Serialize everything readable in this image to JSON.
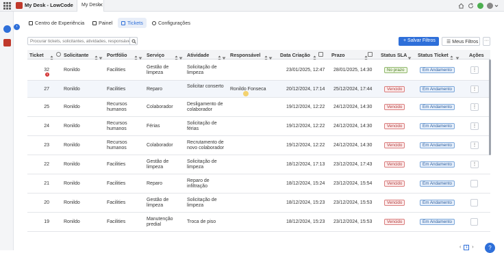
{
  "topbar": {
    "app_title": "My Desk - LowCode",
    "tab_label": "My Desk",
    "tab_close": "✕"
  },
  "nav": [
    {
      "label": "Centro de Experiência"
    },
    {
      "label": "Painel"
    },
    {
      "label": "Tickets"
    },
    {
      "label": "Configurações"
    }
  ],
  "search": {
    "placeholder": "Procurar tickets, solicitantes, atividades, responsável..."
  },
  "actions": {
    "save": "Salvar Filtros",
    "filters": "Meus Filtros",
    "more": "···"
  },
  "columns": [
    "Ticket",
    "Solicitante",
    "Portfólio",
    "Serviço",
    "Atividade",
    "Responsável",
    "Data Criação",
    "Prazo",
    "Status SLA",
    "Status Ticket",
    "Ações"
  ],
  "rows": [
    {
      "ticket": "32",
      "badge": "1",
      "solicitante": "Ronildo",
      "portfolio": "Facilities",
      "servico": "Gestão de limpeza",
      "atividade": "Solicitação de limpeza",
      "responsavel": "",
      "criacao": "23/01/2025, 12:47",
      "prazo": "28/01/2025, 14:30",
      "sla": "No prazo",
      "status": "Em Andamento",
      "acao": "⋮"
    },
    {
      "ticket": "27",
      "badge": "",
      "solicitante": "Ronildo",
      "portfolio": "Facilities",
      "servico": "Reparo",
      "atividade": "Solicitar conserto",
      "responsavel": "Ronildo Fonseca",
      "criacao": "20/12/2024, 17:14",
      "prazo": "25/12/2024, 17:44",
      "sla": "Vencido",
      "status": "Em Andamento",
      "acao": "⋮"
    },
    {
      "ticket": "25",
      "badge": "",
      "solicitante": "Ronildo",
      "portfolio": "Recursos humanos",
      "servico": "Colaborador",
      "atividade": "Desligamento de colaborador",
      "responsavel": "",
      "criacao": "19/12/2024, 12:22",
      "prazo": "24/12/2024, 14:30",
      "sla": "Vencido",
      "status": "Em Andamento",
      "acao": "⋮"
    },
    {
      "ticket": "24",
      "badge": "",
      "solicitante": "Ronildo",
      "portfolio": "Recursos humanos",
      "servico": "Férias",
      "atividade": "Solicitação de férias",
      "responsavel": "",
      "criacao": "19/12/2024, 12:22",
      "prazo": "24/12/2024, 14:30",
      "sla": "Vencido",
      "status": "Em Andamento",
      "acao": "⋮"
    },
    {
      "ticket": "23",
      "badge": "",
      "solicitante": "Ronildo",
      "portfolio": "Recursos humanos",
      "servico": "Colaborador",
      "atividade": "Recrutamento de novo colaborador",
      "responsavel": "",
      "criacao": "19/12/2024, 12:22",
      "prazo": "24/12/2024, 14:30",
      "sla": "Vencido",
      "status": "Em Andamento",
      "acao": "⋮"
    },
    {
      "ticket": "22",
      "badge": "",
      "solicitante": "Ronildo",
      "portfolio": "Facilities",
      "servico": "Gestão de limpeza",
      "atividade": "Solicitação de limpeza",
      "responsavel": "",
      "criacao": "18/12/2024, 17:13",
      "prazo": "23/12/2024, 17:43",
      "sla": "Vencido",
      "status": "Em Andamento",
      "acao": "⋮"
    },
    {
      "ticket": "21",
      "badge": "",
      "solicitante": "Ronildo",
      "portfolio": "Facilities",
      "servico": "Reparo",
      "atividade": "Reparo de infiltração",
      "responsavel": "",
      "criacao": "18/12/2024, 15:24",
      "prazo": "23/12/2024, 15:54",
      "sla": "Vencido",
      "status": "Em Andamento",
      "acao": ""
    },
    {
      "ticket": "20",
      "badge": "",
      "solicitante": "Ronildo",
      "portfolio": "Facilities",
      "servico": "Gestão de limpeza",
      "atividade": "Solicitação de limpeza",
      "responsavel": "",
      "criacao": "18/12/2024, 15:23",
      "prazo": "23/12/2024, 15:53",
      "sla": "Vencido",
      "status": "Em Andamento",
      "acao": ""
    },
    {
      "ticket": "19",
      "badge": "",
      "solicitante": "Ronildo",
      "portfolio": "Facilities",
      "servico": "Manutenção predial",
      "atividade": "Troca de piso",
      "responsavel": "",
      "criacao": "18/12/2024, 15:23",
      "prazo": "23/12/2024, 15:53",
      "sla": "Vencido",
      "status": "Em Andamento",
      "acao": ""
    }
  ],
  "pager": {
    "prev": "‹",
    "page": "1",
    "next": "›"
  },
  "help": "?",
  "colors": {
    "accent": "#2e6fd9",
    "overdue": "#b23c3c",
    "ontime": "#4a7a22"
  }
}
